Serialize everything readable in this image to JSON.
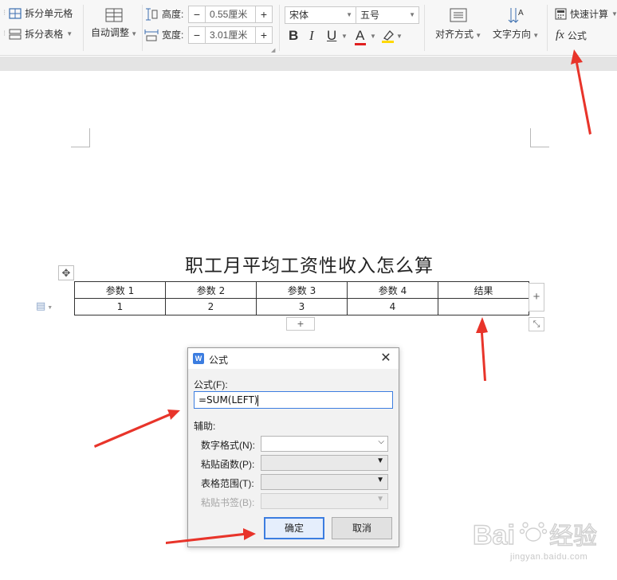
{
  "ribbon": {
    "split_cells": "拆分单元格",
    "split_table": "拆分表格",
    "auto_fit": "自动调整",
    "height_label": "高度:",
    "height_value": "0.55厘米",
    "width_label": "宽度:",
    "width_value": "3.01厘米",
    "minus": "−",
    "plus": "+",
    "font_name": "宋体",
    "font_size": "五号",
    "bold": "B",
    "italic": "I",
    "underline": "U",
    "font_color": "A",
    "align": "对齐方式",
    "text_direction": "文字方向",
    "quick_calc": "快速计算",
    "fx": "fx",
    "formula": "公式"
  },
  "document": {
    "title": "职工月平均工资性收入怎么算",
    "table": {
      "headers": [
        "参数 1",
        "参数 2",
        "参数 3",
        "参数 4",
        "结果"
      ],
      "row": [
        "1",
        "2",
        "3",
        "4",
        ""
      ]
    },
    "add_col": "+",
    "add_row": "+"
  },
  "dialog": {
    "title": "公式",
    "app_icon": "W",
    "close": "✕",
    "formula_label": "公式(F):",
    "formula_value": "=SUM(LEFT)",
    "aux_label": "辅助:",
    "number_format_label": "数字格式(N):",
    "paste_function_label": "粘贴函数(P):",
    "table_range_label": "表格范围(T):",
    "paste_bookmark_label": "粘贴书签(B):",
    "ok": "确定",
    "cancel": "取消"
  },
  "watermark": {
    "brand": "Baidu经验",
    "url": "jingyan.baidu.com"
  },
  "colors": {
    "accent": "#3c7de0",
    "arrow": "#e8342a",
    "font_color_bar": "#e02020",
    "highlight_bar": "#ffd800"
  }
}
